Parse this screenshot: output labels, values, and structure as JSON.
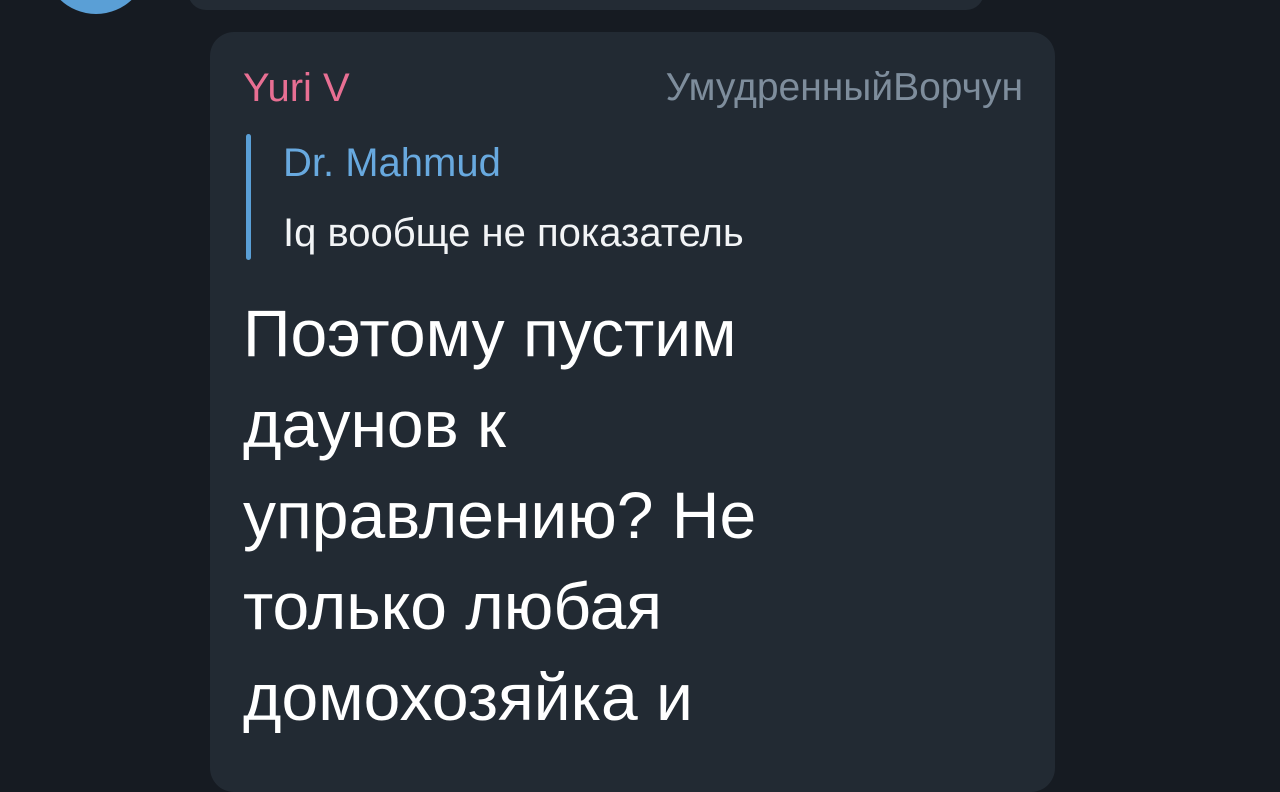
{
  "chat": {
    "message": {
      "sender": "Yuri V",
      "author_title": "УмудренныйВорчун",
      "reply": {
        "name": "Dr. Mahmud",
        "text": "Iq вообще не показатель"
      },
      "text": "Поэтому пустим\nдаунов к\nуправлению? Не\nтолько любая\nдомохозяйка и"
    }
  },
  "colors": {
    "background": "#161b22",
    "bubble": "#222a33",
    "sender_name": "#e86f93",
    "reply_accent": "#5a9fd6",
    "author_title": "#7e8d9c",
    "message_text": "#ffffff"
  },
  "icons": {
    "avatar": "user-avatar-icon"
  }
}
